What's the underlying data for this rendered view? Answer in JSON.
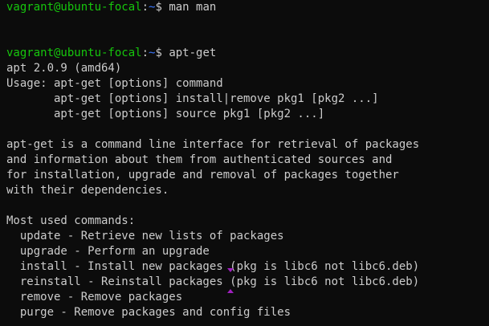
{
  "colors": {
    "background": "#0c0c0c",
    "text": "#cccccc",
    "prompt_user": "#16c60c",
    "prompt_path": "#3b78ff",
    "marker": "#a020c0"
  },
  "prompt": {
    "user_host": "vagrant@ubuntu-focal",
    "separator": ":",
    "path": "~",
    "symbol": "$ "
  },
  "commands": [
    "man man",
    "apt-get"
  ],
  "output_lines": [
    "apt 2.0.9 (amd64)",
    "Usage: apt-get [options] command",
    "       apt-get [options] install|remove pkg1 [pkg2 ...]",
    "       apt-get [options] source pkg1 [pkg2 ...]",
    "",
    "apt-get is a command line interface for retrieval of packages",
    "and information about them from authenticated sources and",
    "for installation, upgrade and removal of packages together",
    "with their dependencies.",
    "",
    "Most used commands:",
    "  update - Retrieve new lists of packages",
    "  upgrade - Perform an upgrade",
    "  install - Install new packages (pkg is libc6 not libc6.deb)",
    "  reinstall - Reinstall packages (pkg is libc6 not libc6.deb)",
    "  remove - Remove packages",
    "  purge - Remove packages and config files"
  ]
}
